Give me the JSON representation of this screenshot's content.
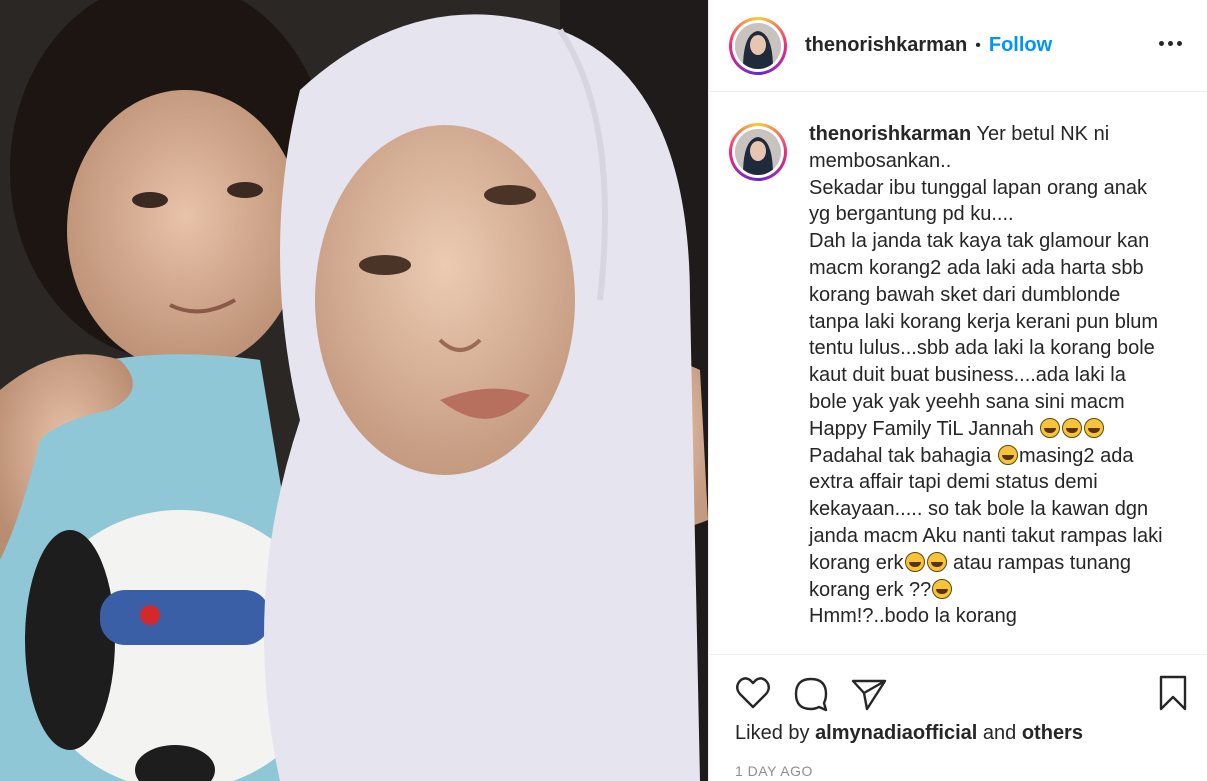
{
  "post": {
    "username": "thenorishkarman",
    "separator": "•",
    "follow_label": "Follow",
    "more_icon": "more-options-icon",
    "photo_description_icon": "post-photo"
  },
  "caption": {
    "username": "thenorishkarman",
    "parts": [
      " Yer betul NK ni membosankan..\nSekadar ibu tunggal lapan orang anak yg bergantung pd ku....\nDah la janda tak kaya tak glamour kan macm korang2 ada laki ada harta sbb korang bawah sket dari dumblonde tanpa laki korang kerja kerani pun blum tentu lulus...sbb ada laki la korang bole kaut duit buat business....ada laki la bole yak yak yeehh sana sini macm Happy Family TiL Jannah ",
      "\nPadahal tak bahagia ",
      "masing2 ada extra affair tapi demi status demi kekayaan..... so tak bole la kawan dgn janda macm Aku nanti takut rampas laki korang erk",
      " atau rampas tunang korang erk ??",
      "\nHmm!?..bodo la korang "
    ],
    "emoji_name": "rolling-on-floor-laughing-emoji"
  },
  "actions": {
    "like_icon": "heart-icon",
    "comment_icon": "comment-icon",
    "share_icon": "share-icon",
    "save_icon": "bookmark-icon"
  },
  "likes": {
    "prefix": "Liked by",
    "user": "almynadiaofficial",
    "middle": "and",
    "others": "others"
  },
  "timestamp": "1 DAY AGO",
  "colors": {
    "accent": "#0095f6",
    "text": "#262626",
    "muted": "#8e8e8e",
    "border": "#efefef"
  }
}
